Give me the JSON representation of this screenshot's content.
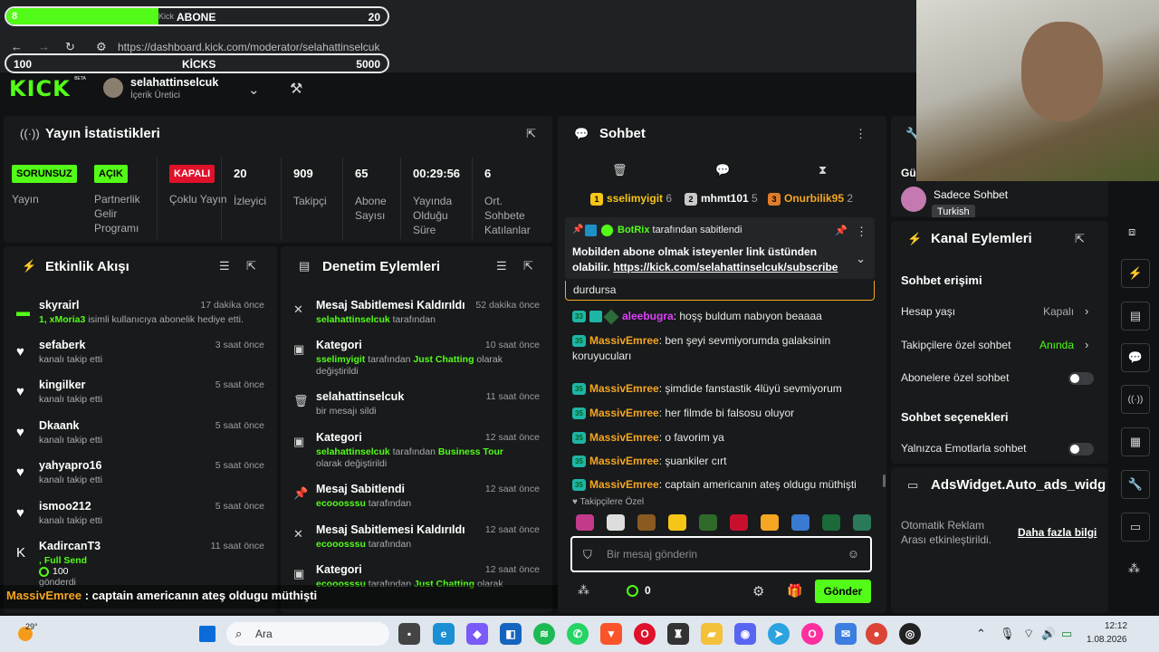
{
  "overlay": {
    "abone_bar": {
      "current": "8",
      "label": "ABONE",
      "label_prefix": "Kick",
      "target": "20",
      "progress": 0.4
    },
    "kicks_bar": {
      "current": "100",
      "label": "KİCKS",
      "target": "5000",
      "progress": 0.0
    },
    "chat_ticker": {
      "user": "MassivEmree",
      "text": " : captain americanın ateş oldugu müthişti"
    }
  },
  "browser": {
    "url": "https://dashboard.kick.com/moderator/selahattinselcuk"
  },
  "header": {
    "logo": "KICK",
    "logo_sup": "BETA",
    "user_name": "selahattinselcuk",
    "user_role": "İçerik Üretici"
  },
  "stats": {
    "title": "Yayın İstatistikleri",
    "items": [
      {
        "badge": "SORUNSUZ",
        "label": "Yayın",
        "color": "#53fc18"
      },
      {
        "badge": "AÇIK",
        "label": "Partnerlik Gelir Programı",
        "color": "#53fc18"
      },
      {
        "badge": "KAPALI",
        "label": "Çoklu Yayın",
        "color": "#e0112b"
      },
      {
        "value": "20",
        "label": "İzleyici"
      },
      {
        "value": "909",
        "label": "Takipçi"
      },
      {
        "value": "65",
        "label": "Abone Sayısı"
      },
      {
        "value": "00:29:56",
        "label": "Yayında Olduğu Süre"
      },
      {
        "value": "6",
        "label": "Ort. Sohbete Katılanlar"
      }
    ]
  },
  "activity": {
    "title": "Etkinlik Akışı",
    "items": [
      {
        "name": "skyrairl",
        "sub_green": "1, xMoria3",
        "sub": " isimli kullanıcıya abonelik hediye etti.",
        "time": "17 dakika önce",
        "icon": "gift-icon"
      },
      {
        "name": "sefaberk",
        "sub": "kanalı takip etti",
        "time": "3 saat önce",
        "icon": "heart-icon"
      },
      {
        "name": "kingilker",
        "sub": "kanalı takip etti",
        "time": "5 saat önce",
        "icon": "heart-icon"
      },
      {
        "name": "Dkaank",
        "sub": "kanalı takip etti",
        "time": "5 saat önce",
        "icon": "heart-icon"
      },
      {
        "name": "yahyapro16",
        "sub": "kanalı takip etti",
        "time": "5 saat önce",
        "icon": "heart-icon"
      },
      {
        "name": "ismoo212",
        "sub": "kanalı takip etti",
        "time": "5 saat önce",
        "icon": "heart-icon"
      },
      {
        "name": "KadircanT3",
        "sub_green": ", Full Send",
        "amount": "100",
        "sub": "gönderdi",
        "time": "11 saat önce",
        "icon": "kick-coin-icon"
      }
    ]
  },
  "moderation": {
    "title": "Denetim Eylemleri",
    "items": [
      {
        "title": "Mesaj Sabitlemesi Kaldırıldı",
        "actor": "selahattinselcuk",
        "suffix": " tarafından",
        "time": "52 dakika önce"
      },
      {
        "title": "Kategori",
        "actor": "sselimyigit",
        "suffix": " tarafından ",
        "cat": "Just Chatting",
        "suffix2": " olarak değiştirildi",
        "time": "10 saat önce"
      },
      {
        "title": "selahattinselcuk",
        "plain": "bir mesajı sildi",
        "time": "11 saat önce"
      },
      {
        "title": "Kategori",
        "actor": "selahattinselcuk",
        "suffix": " tarafından ",
        "cat": "Business Tour",
        "suffix2": " olarak değiştirildi",
        "time": "12 saat önce"
      },
      {
        "title": "Mesaj Sabitlendi",
        "actor": "ecooosssu",
        "suffix": " tarafından",
        "time": "12 saat önce"
      },
      {
        "title": "Mesaj Sabitlemesi Kaldırıldı",
        "actor": "ecooosssu",
        "suffix": " tarafından",
        "time": "12 saat önce"
      },
      {
        "title": "Kategori",
        "actor": "ecooosssu",
        "suffix": " tarafından ",
        "cat": "Just Chatting",
        "suffix2": " olarak",
        "time": "12 saat önce"
      }
    ]
  },
  "chat": {
    "title": "Sohbet",
    "leaders": [
      {
        "rank": "1",
        "name": "sselimyigit",
        "count": "6",
        "color": "#f5c518"
      },
      {
        "rank": "2",
        "name": "mhmt101",
        "count": "5",
        "color": "#c9c9c9"
      },
      {
        "rank": "3",
        "name": "Onurbilik95",
        "count": "2",
        "color": "#e07b2a"
      }
    ],
    "pinned": {
      "by": "BotRix",
      "suffix": " tarafından sabitlendi",
      "text": "Mobilden abone olmak isteyenler link üstünden olabilir. ",
      "link": "https://kick.com/selahattinselcuk/subscribe"
    },
    "partial": "durdursa",
    "messages": [
      {
        "badge": "33",
        "user": "aleebugra",
        "text": ": hoşş buldum nabıyon beaaaa",
        "color": "#e040fb"
      },
      {
        "badge": "35",
        "user": "MassivEmree",
        "text": ": ben şeyi sevmiyorumda galaksinin koruyucuları",
        "color": "#f5a623"
      },
      {
        "badge": "35",
        "user": "MassivEmree",
        "text": ": şimdide fanstastik 4lüyü sevmiyorum",
        "color": "#f5a623"
      },
      {
        "badge": "35",
        "user": "MassivEmree",
        "text": ": her filmde bi falsosu oluyor",
        "color": "#f5a623"
      },
      {
        "badge": "35",
        "user": "MassivEmree",
        "text": ": o favorim ya",
        "color": "#f5a623"
      },
      {
        "badge": "35",
        "user": "MassivEmree",
        "text": ": şuankiler cırt",
        "color": "#f5a623"
      },
      {
        "badge": "35",
        "user": "MassivEmree",
        "text": ": captain americanın ateş oldugu müthişti",
        "color": "#f5a623"
      }
    ],
    "followers_only": "Takipçilere Özel",
    "input_placeholder": "Bir mesaj gönderin",
    "kicks_count": "0",
    "send": "Gönder"
  },
  "right": {
    "gu_label": "Gü",
    "mode_title": "Sadece Sohbet",
    "mode_lang": "Turkish",
    "channel_actions": "Kanal Eylemleri",
    "chat_access": "Sohbet erişimi",
    "account_age": "Hesap yaşı",
    "account_age_val": "Kapalı",
    "followers_chat": "Takipçilere özel sohbet",
    "followers_chat_val": "Anında",
    "subs_chat": "Abonelere özel sohbet",
    "chat_options": "Sohbet seçenekleri",
    "emote_only": "Yalnızca Emotlarla sohbet",
    "ads_title": "AdsWidget.Auto_ads_widg",
    "ads_text": "Otomatik Reklam Arası etkinleştirildi.",
    "ads_link": "Daha fazla bilgi"
  },
  "taskbar": {
    "temp": "29°",
    "search": "Ara",
    "time": "12:12",
    "date": "1.08.2026"
  }
}
